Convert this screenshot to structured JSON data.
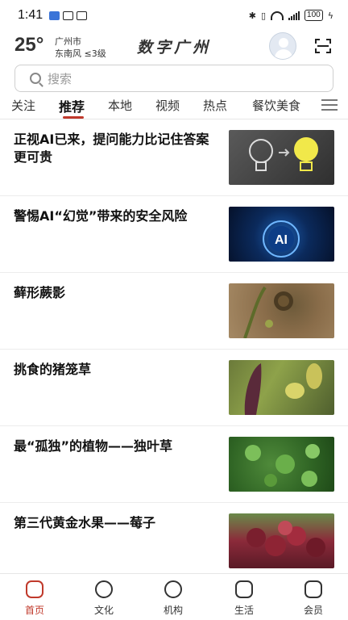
{
  "status_bar": {
    "time": "1:41",
    "battery": "100"
  },
  "header": {
    "temperature": "25°",
    "city": "广州市",
    "wind": "东南风  ≤3级",
    "app_title": "数字广州"
  },
  "search": {
    "placeholder": "搜索"
  },
  "tabs": [
    {
      "label": "关注",
      "active": false
    },
    {
      "label": "推荐",
      "active": true
    },
    {
      "label": "本地",
      "active": false
    },
    {
      "label": "视频",
      "active": false
    },
    {
      "label": "热点",
      "active": false
    },
    {
      "label": "餐饮美食",
      "active": false
    }
  ],
  "news": [
    {
      "title": "正视AI已来，提问能力比记住答案更可贵",
      "thumbnail": "lightbulbs"
    },
    {
      "title": "警惕AI“幻觉”带来的安全风险",
      "thumbnail": "ai-chip",
      "thumbnail_text": "AI"
    },
    {
      "title": "藓形蕨影",
      "thumbnail": "fern"
    },
    {
      "title": "挑食的猪笼草",
      "thumbnail": "pitcher-plant"
    },
    {
      "title": "最“孤独”的植物——独叶草",
      "thumbnail": "clover-plant"
    },
    {
      "title": "第三代黄金水果——莓子",
      "thumbnail": "berries"
    }
  ],
  "bottom_nav": [
    {
      "label": "首页",
      "icon": "home-icon",
      "active": true
    },
    {
      "label": "文化",
      "icon": "culture-icon",
      "active": false
    },
    {
      "label": "机构",
      "icon": "institution-icon",
      "active": false
    },
    {
      "label": "生活",
      "icon": "life-icon",
      "active": false
    },
    {
      "label": "会员",
      "icon": "member-icon",
      "active": false
    }
  ],
  "colors": {
    "accent": "#c0392b",
    "divider": "#e6e6e6"
  }
}
